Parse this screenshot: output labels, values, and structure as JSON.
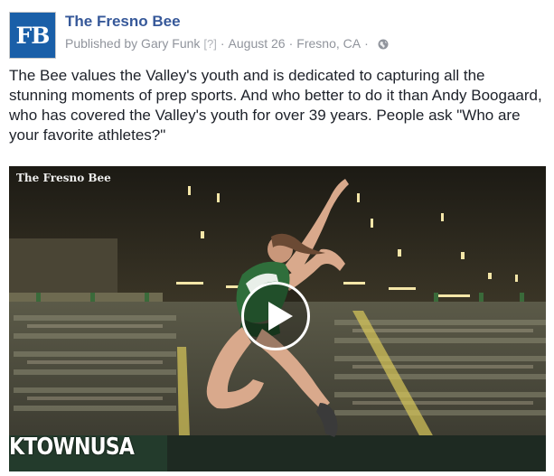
{
  "post": {
    "page_logo_text": "FB",
    "page_name": "The Fresno Bee",
    "meta": {
      "published_by": "Published by Gary Funk",
      "help_marker": "[?]",
      "date": "August 26",
      "location": "Fresno, CA",
      "separator": "·",
      "privacy_icon": "globe-icon"
    },
    "text": "The Bee values the Valley's youth and is dedicated to capturing all the stunning moments of prep sports. And who better to do it than Andy Boogaard, who has covered the Valley's youth for over 39 years. People ask \"Who are your favorite athletes?\"",
    "video": {
      "watermark": "The Fresno Bee",
      "signage": "KTOWNUSA",
      "play_icon": "play-icon"
    }
  },
  "colors": {
    "link_blue": "#365899",
    "meta_gray": "#90949c",
    "text": "#1d2129",
    "logo_blue": "#1a5fa8"
  }
}
